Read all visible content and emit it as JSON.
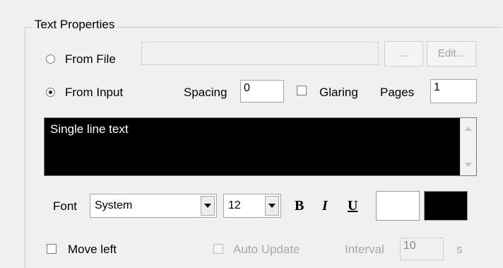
{
  "group": {
    "title": "Text Properties"
  },
  "source": {
    "from_file_label": "From File",
    "from_file_selected": false,
    "file_path": "",
    "browse_label": "...",
    "edit_label": "Edit...",
    "from_input_label": "From Input",
    "from_input_selected": true
  },
  "options": {
    "spacing_label": "Spacing",
    "spacing_value": "0",
    "glaring_label": "Glaring",
    "glaring_checked": false,
    "pages_label": "Pages",
    "pages_value": "1"
  },
  "text_input": {
    "value": "Single line text"
  },
  "font": {
    "label": "Font",
    "family": "System",
    "size": "12",
    "bold_label": "B",
    "italic_label": "I",
    "underline_label": "U",
    "fg_color": "#ffffff",
    "bg_color": "#000000"
  },
  "bottom": {
    "move_left_label": "Move left",
    "move_left_checked": false,
    "auto_update_label": "Auto Update",
    "auto_update_checked": false,
    "interval_label": "Interval",
    "interval_value": "10",
    "interval_unit": "s"
  }
}
